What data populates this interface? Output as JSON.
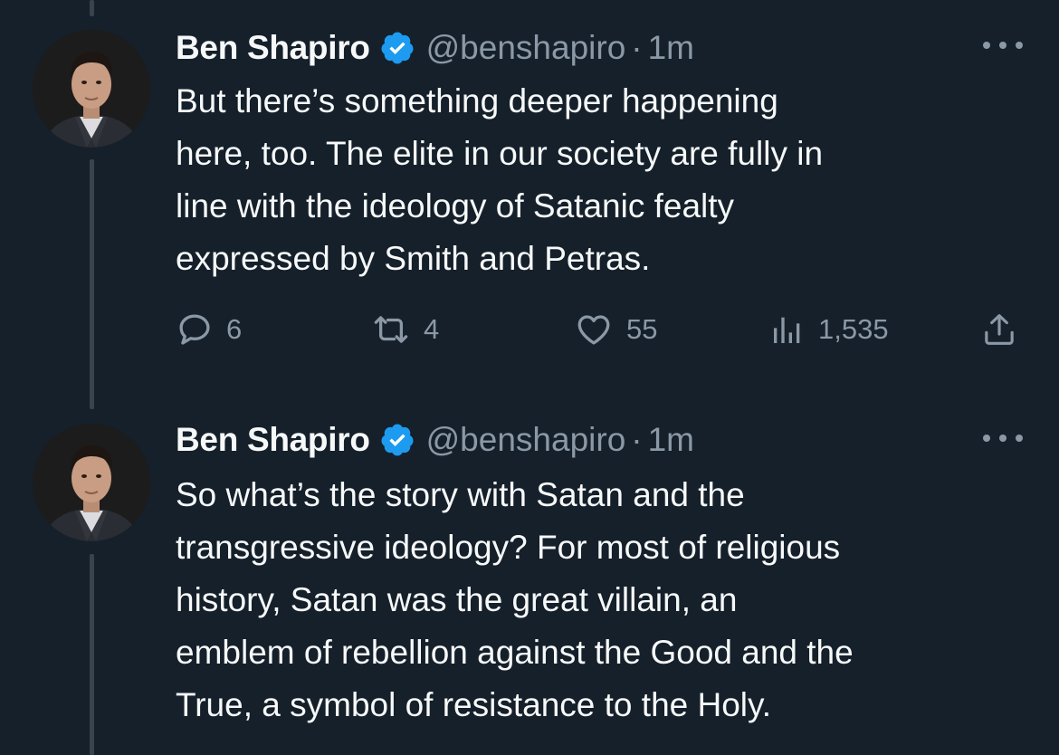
{
  "tweets": [
    {
      "author_name": "Ben Shapiro",
      "verified": true,
      "handle": "@benshapiro",
      "separator": "·",
      "time": "1m",
      "text_lines": [
        "But there’s something deeper happening",
        "here, too. The elite in our society are fully in",
        "line with the ideology of Satanic fealty",
        "expressed by Smith and Petras."
      ],
      "replies": "6",
      "retweets": "4",
      "likes": "55",
      "views": "1,535"
    },
    {
      "author_name": "Ben Shapiro",
      "verified": true,
      "handle": "@benshapiro",
      "separator": "·",
      "time": "1m",
      "text_lines": [
        "So what’s the story with Satan and the",
        "transgressive ideology? For most of religious",
        "history, Satan was the great villain, an",
        "emblem of rebellion against the Good and the",
        "True, a symbol of resistance to the Holy."
      ]
    }
  ],
  "icons": {
    "verified": "verified-badge-icon",
    "more": "more-options-icon",
    "reply": "reply-icon",
    "retweet": "retweet-icon",
    "like": "heart-icon",
    "views": "views-icon",
    "share": "share-icon"
  },
  "colors": {
    "background": "#15202b",
    "primary_text": "#f7f9f9",
    "secondary_text": "#8b98a5",
    "verified_blue": "#1d9bf0",
    "thread_line": "#38444d"
  }
}
